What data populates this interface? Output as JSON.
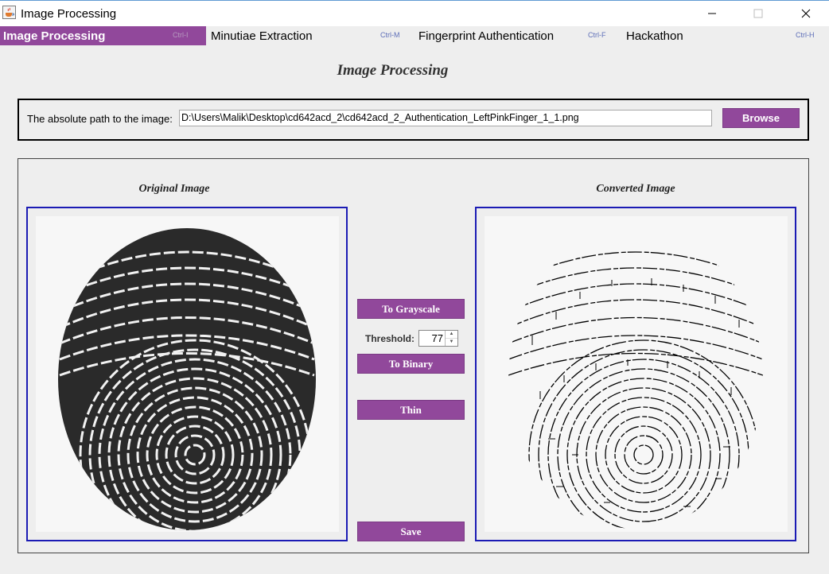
{
  "window": {
    "title": "Image Processing"
  },
  "menu": [
    {
      "label": "Image Processing",
      "accelerator": "Ctrl-I",
      "active": true
    },
    {
      "label": "Minutiae Extraction",
      "accelerator": "Ctrl-M",
      "active": false
    },
    {
      "label": "Fingerprint Authentication",
      "accelerator": "Ctrl-F",
      "active": false
    },
    {
      "label": "Hackathon",
      "accelerator": "Ctrl-H",
      "active": false
    }
  ],
  "page": {
    "title": "Image Processing"
  },
  "path_panel": {
    "label": "The absolute path to the image:",
    "value": "D:\\Users\\Malik\\Desktop\\cd642acd_2\\cd642acd_2_Authentication_LeftPinkFinger_1_1.png",
    "browse_label": "Browse"
  },
  "images": {
    "original_heading": "Original Image",
    "converted_heading": "Converted Image"
  },
  "controls": {
    "grayscale_label": "To Grayscale",
    "threshold_label": "Threshold:",
    "threshold_value": "77",
    "binary_label": "To Binary",
    "thin_label": "Thin",
    "save_label": "Save"
  },
  "colors": {
    "accent": "#91489b",
    "frame_border": "#1b1bb4",
    "background": "#eeeeee",
    "accelerator_text": "#5d6eb8"
  },
  "icons": {
    "app": "java-cup-icon",
    "minimize": "minimize-icon",
    "maximize": "maximize-icon",
    "close": "close-icon",
    "spinner_up": "spinner-up-icon",
    "spinner_down": "spinner-down-icon"
  }
}
